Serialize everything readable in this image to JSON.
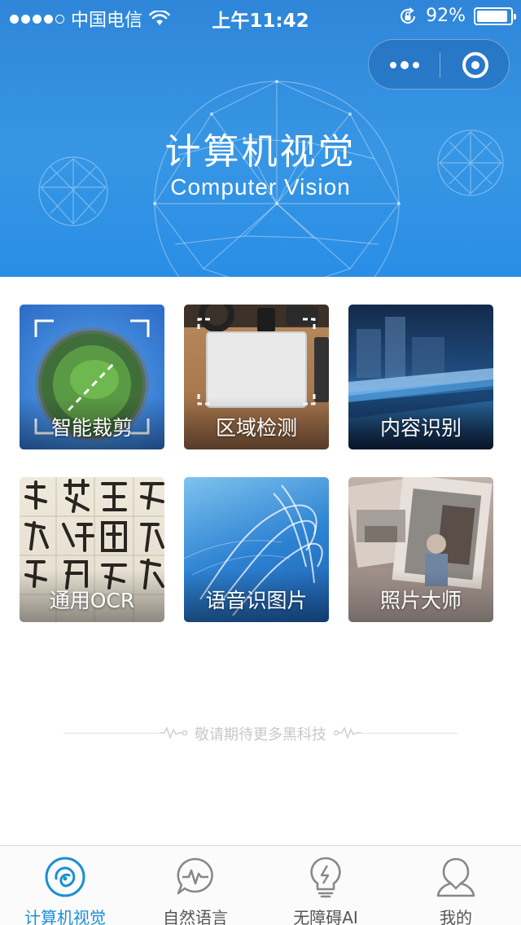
{
  "status_bar": {
    "carrier": "中国电信",
    "time": "上午11:42",
    "battery_percent": "92%",
    "battery_level": 0.92,
    "signal_bars_filled": 4,
    "signal_bars_total": 5
  },
  "header": {
    "title": "计算机视觉",
    "subtitle": "Computer Vision",
    "capsule_more_icon": "more-dots-icon",
    "capsule_close_icon": "target-ring-icon"
  },
  "features": [
    {
      "label": "智能裁剪"
    },
    {
      "label": "区域检测"
    },
    {
      "label": "内容识别"
    },
    {
      "label": "通用OCR"
    },
    {
      "label": "语音识图片"
    },
    {
      "label": "照片大师"
    }
  ],
  "footer_note": "敬请期待更多黑科技",
  "tabbar": {
    "items": [
      {
        "label": "计算机视觉",
        "icon": "vision-swirl-icon",
        "active": true
      },
      {
        "label": "自然语言",
        "icon": "chat-wave-icon",
        "active": false
      },
      {
        "label": "无障碍AI",
        "icon": "lightbulb-icon",
        "active": false
      },
      {
        "label": "我的",
        "icon": "person-icon",
        "active": false
      }
    ]
  },
  "colors": {
    "header_blue": "#3796e4",
    "active_tab": "#1a8fd6",
    "inactive_tab": "#555555",
    "note_gray": "#c8c8c8"
  }
}
